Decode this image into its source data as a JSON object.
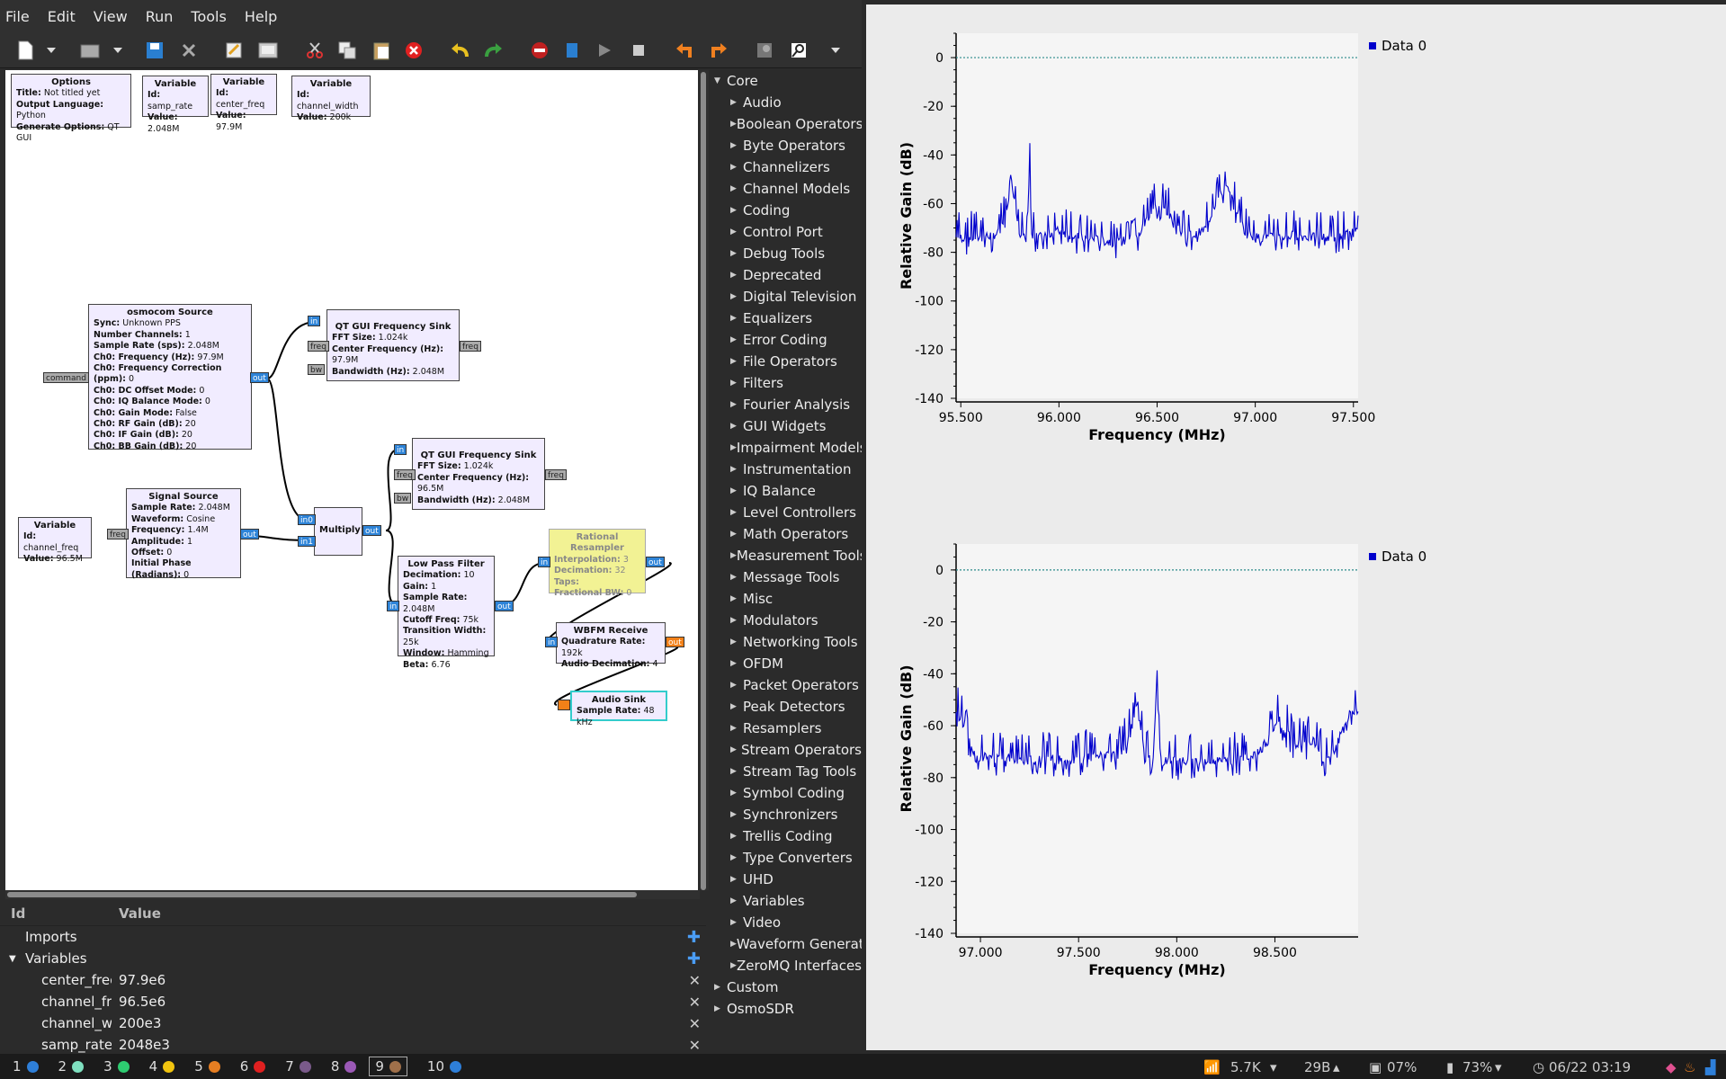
{
  "menu": [
    "File",
    "Edit",
    "View",
    "Run",
    "Tools",
    "Help"
  ],
  "toolbar_icons": [
    "new-icon",
    "new-dropdown-icon",
    "open-icon",
    "open-dropdown-icon",
    "save-icon",
    "close-icon",
    "properties-icon",
    "screenshot-icon",
    "cut-icon",
    "copy-icon",
    "paste-icon",
    "delete-icon",
    "undo-icon",
    "redo-icon",
    "disable-icon",
    "generate-icon",
    "execute-icon",
    "kill-icon",
    "rotate-ccw-icon",
    "rotate-cw-icon",
    "find-icon",
    "search-icon",
    "more-icon"
  ],
  "blocks": {
    "options": {
      "title": "Options",
      "rows": [
        [
          "Title:",
          "Not titled yet"
        ],
        [
          "Output Language:",
          "Python"
        ],
        [
          "Generate Options:",
          "QT GUI"
        ]
      ]
    },
    "var1": {
      "title": "Variable",
      "rows": [
        [
          "Id:",
          "samp_rate"
        ],
        [
          "Value:",
          "2.048M"
        ]
      ]
    },
    "var2": {
      "title": "Variable",
      "rows": [
        [
          "Id:",
          "center_freq"
        ],
        [
          "Value:",
          "97.9M"
        ]
      ]
    },
    "var3": {
      "title": "Variable",
      "rows": [
        [
          "Id:",
          "channel_width"
        ],
        [
          "Value:",
          "200k"
        ]
      ]
    },
    "var4": {
      "title": "Variable",
      "rows": [
        [
          "Id:",
          "channel_freq"
        ],
        [
          "Value:",
          "96.5M"
        ]
      ]
    },
    "osmo": {
      "title": "osmocom Source",
      "rows": [
        [
          "Sync:",
          "Unknown PPS"
        ],
        [
          "Number Channels:",
          "1"
        ],
        [
          "Sample Rate (sps):",
          "2.048M"
        ],
        [
          "Ch0: Frequency (Hz):",
          "97.9M"
        ],
        [
          "Ch0: Frequency Correction (ppm):",
          "0"
        ],
        [
          "Ch0: DC Offset Mode:",
          "0"
        ],
        [
          "Ch0: IQ Balance Mode:",
          "0"
        ],
        [
          "Ch0: Gain Mode:",
          "False"
        ],
        [
          "Ch0: RF Gain (dB):",
          "20"
        ],
        [
          "Ch0: IF Gain (dB):",
          "20"
        ],
        [
          "Ch0: BB Gain (dB):",
          "20"
        ]
      ]
    },
    "fsink1": {
      "title": "QT GUI Frequency Sink",
      "rows": [
        [
          "FFT Size:",
          "1.024k"
        ],
        [
          "Center Frequency (Hz):",
          "97.9M"
        ],
        [
          "Bandwidth (Hz):",
          "2.048M"
        ]
      ]
    },
    "fsink2": {
      "title": "QT GUI Frequency Sink",
      "rows": [
        [
          "FFT Size:",
          "1.024k"
        ],
        [
          "Center Frequency (Hz):",
          "96.5M"
        ],
        [
          "Bandwidth (Hz):",
          "2.048M"
        ]
      ]
    },
    "sigsrc": {
      "title": "Signal Source",
      "rows": [
        [
          "Sample Rate:",
          "2.048M"
        ],
        [
          "Waveform:",
          "Cosine"
        ],
        [
          "Frequency:",
          "1.4M"
        ],
        [
          "Amplitude:",
          "1"
        ],
        [
          "Offset:",
          "0"
        ],
        [
          "Initial Phase (Radians):",
          "0"
        ]
      ]
    },
    "multiply": {
      "title": "Multiply",
      "rows": []
    },
    "lpf": {
      "title": "Low Pass Filter",
      "rows": [
        [
          "Decimation:",
          "10"
        ],
        [
          "Gain:",
          "1"
        ],
        [
          "Sample Rate:",
          "2.048M"
        ],
        [
          "Cutoff Freq:",
          "75k"
        ],
        [
          "Transition Width:",
          "25k"
        ],
        [
          "Window:",
          "Hamming"
        ],
        [
          "Beta:",
          "6.76"
        ]
      ]
    },
    "resamp": {
      "title": "Rational Resampler",
      "rows": [
        [
          "Interpolation:",
          "3"
        ],
        [
          "Decimation:",
          "32"
        ],
        [
          "Taps:",
          ""
        ],
        [
          "Fractional BW:",
          "0"
        ]
      ]
    },
    "wbfm": {
      "title": "WBFM Receive",
      "rows": [
        [
          "Quadrature Rate:",
          "192k"
        ],
        [
          "Audio Decimation:",
          "4"
        ]
      ]
    },
    "asink": {
      "title": "Audio Sink",
      "rows": [
        [
          "Sample Rate:",
          "48 kHz"
        ]
      ]
    }
  },
  "ports": {
    "command": "command",
    "in": "in",
    "out": "out",
    "freq": "freq",
    "bw": "bw",
    "in0": "in0",
    "in1": "in1"
  },
  "var_panel": {
    "col_id": "Id",
    "col_value": "Value",
    "imports": "Imports",
    "variables": "Variables",
    "plus": "✚",
    "close": "✕",
    "rows": [
      {
        "id": "center_frec",
        "value": "97.9e6"
      },
      {
        "id": "channel_fre",
        "value": "96.5e6"
      },
      {
        "id": "channel_wi",
        "value": "200e3"
      },
      {
        "id": "samp_rate",
        "value": "2048e3"
      }
    ]
  },
  "tree": {
    "core": "Core",
    "items": [
      "Audio",
      "Boolean Operators",
      "Byte Operators",
      "Channelizers",
      "Channel Models",
      "Coding",
      "Control Port",
      "Debug Tools",
      "Deprecated",
      "Digital Television",
      "Equalizers",
      "Error Coding",
      "File Operators",
      "Filters",
      "Fourier Analysis",
      "GUI Widgets",
      "Impairment Models",
      "Instrumentation",
      "IQ Balance",
      "Level Controllers",
      "Math Operators",
      "Measurement Tools",
      "Message Tools",
      "Misc",
      "Modulators",
      "Networking Tools",
      "OFDM",
      "Packet Operators",
      "Peak Detectors",
      "Resamplers",
      "Stream Operators",
      "Stream Tag Tools",
      "Symbol Coding",
      "Synchronizers",
      "Trellis Coding",
      "Type Converters",
      "UHD",
      "Variables",
      "Video",
      "Waveform Generators",
      "ZeroMQ Interfaces"
    ],
    "extra": [
      "Custom",
      "OsmoSDR"
    ]
  },
  "chart_data": [
    {
      "type": "line",
      "xlabel": "Frequency (MHz)",
      "ylabel": "Relative Gain (dB)",
      "xlim": [
        95.476,
        97.524
      ],
      "ylim": [
        -140,
        10
      ],
      "xticks": [
        95.5,
        96.0,
        96.5,
        97.0,
        97.5
      ],
      "xticklabels": [
        "95.500",
        "96.000",
        "96.500",
        "97.000",
        "97.500"
      ],
      "yticks": [
        0,
        -20,
        -40,
        -60,
        -80,
        -100,
        -120,
        -140
      ],
      "legend": "Data 0",
      "legend_position": "top-right",
      "reference_line": 0,
      "color": "#0000cc",
      "series": [
        {
          "name": "Data 0",
          "x": [
            95.48,
            95.6,
            95.7,
            95.74,
            95.76,
            95.8,
            95.84,
            95.85,
            95.86,
            95.9,
            96.0,
            96.1,
            96.2,
            96.3,
            96.4,
            96.45,
            96.5,
            96.55,
            96.6,
            96.7,
            96.75,
            96.8,
            96.85,
            96.9,
            96.95,
            97.0,
            97.1,
            97.2,
            97.3,
            97.4,
            97.5
          ],
          "y": [
            -74,
            -74,
            -72,
            -62,
            -51,
            -72,
            -76,
            -39,
            -74,
            -74,
            -71,
            -74,
            -75,
            -76,
            -74,
            -66,
            -60,
            -63,
            -71,
            -73,
            -70,
            -59,
            -53,
            -61,
            -72,
            -74,
            -74,
            -73,
            -74,
            -74,
            -72
          ]
        }
      ]
    },
    {
      "type": "line",
      "xlabel": "Frequency (MHz)",
      "ylabel": "Relative Gain (dB)",
      "xlim": [
        96.876,
        98.924
      ],
      "ylim": [
        -140,
        10
      ],
      "xticks": [
        97.0,
        97.5,
        98.0,
        98.5
      ],
      "xticklabels": [
        "97.000",
        "97.500",
        "98.000",
        "98.500"
      ],
      "yticks": [
        0,
        -20,
        -40,
        -60,
        -80,
        -100,
        -120,
        -140
      ],
      "legend": "Data 0",
      "legend_position": "top-right",
      "reference_line": 0,
      "color": "#0000cc",
      "series": [
        {
          "name": "Data 0",
          "x": [
            96.88,
            96.92,
            96.96,
            97.0,
            97.2,
            97.4,
            97.6,
            97.7,
            97.76,
            97.8,
            97.84,
            97.88,
            97.9,
            97.92,
            98.0,
            98.2,
            98.4,
            98.48,
            98.52,
            98.56,
            98.6,
            98.7,
            98.75,
            98.8,
            98.84,
            98.88,
            98.92
          ],
          "y": [
            -55,
            -60,
            -70,
            -72,
            -73,
            -73,
            -72,
            -72,
            -64,
            -51,
            -72,
            -74,
            -40,
            -74,
            -74,
            -74,
            -72,
            -64,
            -58,
            -62,
            -68,
            -66,
            -74,
            -70,
            -63,
            -55,
            -55
          ]
        }
      ]
    }
  ],
  "status": {
    "workspaces": [
      {
        "n": "1",
        "color": "#2e7fd9"
      },
      {
        "n": "2",
        "color": "#7fe0c0"
      },
      {
        "n": "3",
        "color": "#2ecc71"
      },
      {
        "n": "4",
        "color": "#f1c40f"
      },
      {
        "n": "5",
        "color": "#e67e22"
      },
      {
        "n": "6",
        "color": "#e02020"
      },
      {
        "n": "7",
        "color": "#7a5a8a"
      },
      {
        "n": "8",
        "color": "#9b59b6"
      },
      {
        "n": "9",
        "color": "#a0704a"
      },
      {
        "n": "10",
        "color": "#2e7fd9"
      }
    ],
    "current": "9",
    "net_down": "5.7K",
    "net_up": "29B",
    "cpu": "07%",
    "battery": "73%",
    "datetime": "06/22 03:19"
  }
}
